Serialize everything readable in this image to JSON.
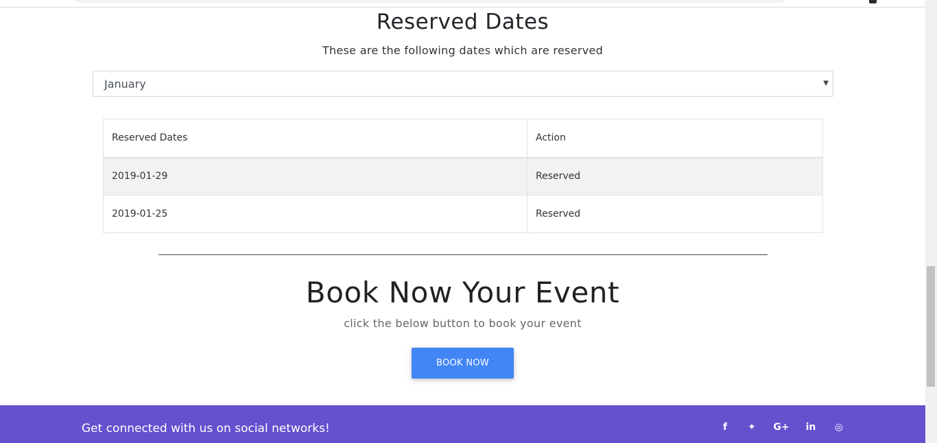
{
  "header": {
    "title": "Reserved Dates",
    "subtitle": "These are the following dates which are reserved"
  },
  "month_select": {
    "selected": "January"
  },
  "reserved_table": {
    "headers": [
      "Reserved Dates",
      "Action"
    ],
    "rows": [
      {
        "date": "2019-01-29",
        "action": "Reserved"
      },
      {
        "date": "2019-01-25",
        "action": "Reserved"
      }
    ]
  },
  "booking": {
    "title": "Book Now Your Event",
    "subtitle": "click the below button to book your event",
    "button_label": "BOOK NOW"
  },
  "footer": {
    "tagline": "Get connected with us on social networks!",
    "social": [
      {
        "name": "facebook-icon",
        "glyph": "f"
      },
      {
        "name": "twitter-icon",
        "glyph": "✦"
      },
      {
        "name": "google-plus-icon",
        "glyph": "G+"
      },
      {
        "name": "linkedin-icon",
        "glyph": "in"
      },
      {
        "name": "instagram-icon",
        "glyph": "◎"
      }
    ]
  },
  "colors": {
    "primary_button": "#4285f4",
    "footer_bg": "#6351ce",
    "striped_row": "#f2f2f2"
  }
}
